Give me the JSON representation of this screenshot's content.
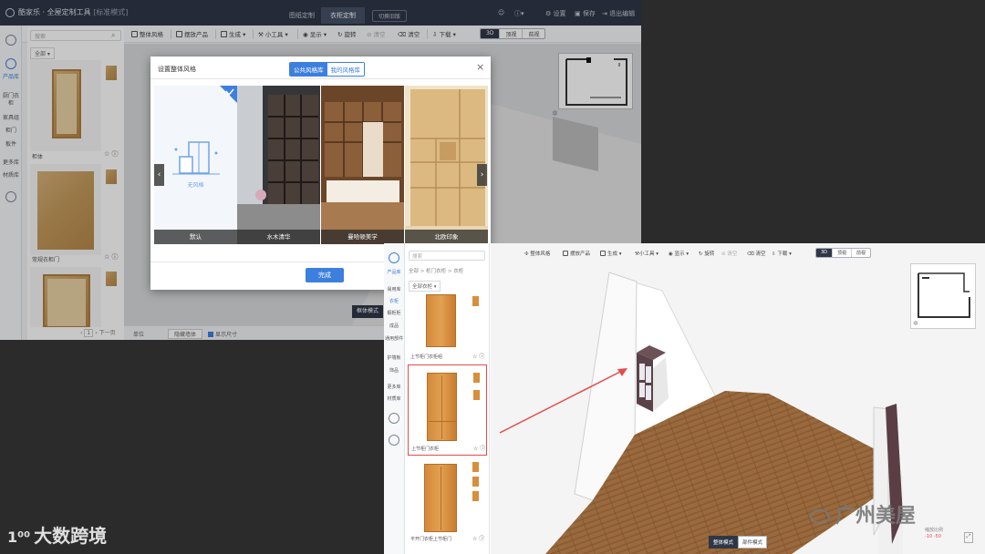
{
  "window1": {
    "app_title": "酷家乐 · 全屋定制工具",
    "mode_badge": "[标准模式]",
    "tabs": [
      "图纸定制",
      "衣柜定制"
    ],
    "switch_label": "切换旧版",
    "top_right": [
      "设置",
      "保存",
      "退出编辑"
    ],
    "toolbar": [
      "整体风格",
      "摆放产品",
      "生成",
      "小工具",
      "显示",
      "旋转",
      "清空",
      "清空",
      "下载"
    ],
    "view_modes": [
      "3D",
      "顶视",
      "前视"
    ],
    "rail": {
      "product_lib": "产品库",
      "cats": [
        "厨门衣柜",
        "家具组",
        "柜门",
        "板件"
      ],
      "more1": "更多库",
      "more2": "材质库"
    },
    "search_placeholder": "搜索",
    "filter_label": "全部",
    "products": [
      {
        "caption": "柜体"
      },
      {
        "caption": "常规衣柜门"
      },
      {
        "caption": ""
      }
    ],
    "pager": {
      "page": "1",
      "next": "下一页"
    },
    "bottom": [
      "单位",
      "隐藏墙体",
      "显示尺寸"
    ],
    "frame_mode_btn": "框体模式"
  },
  "modal": {
    "title": "设置整体风格",
    "tabs": [
      "公共风格库",
      "我的风格库"
    ],
    "close": "×",
    "cards": [
      {
        "label": "默认",
        "placeholder": "无风格"
      },
      {
        "label": "水木清华"
      },
      {
        "label": "曼哈顿美学"
      },
      {
        "label": "北欧印象"
      }
    ],
    "done": "完成"
  },
  "window2": {
    "search_placeholder": "搜索",
    "breadcrumb": "全部 > 柜门衣柜 > 衣柜",
    "filter_label": "全部衣柜",
    "rail": {
      "product_lib": "产品库",
      "cats": [
        "易用库",
        "衣柜",
        "橱柜柜",
        "成品",
        "通用部件",
        "护墙板",
        "饰品"
      ],
      "more1": "更多库",
      "more2": "材质库"
    },
    "products": [
      {
        "caption": "上节柜门衣柜组"
      },
      {
        "caption": "上节柜门衣柜"
      },
      {
        "caption": "平开门衣柜上节柜门"
      }
    ],
    "toolbar": [
      "整体风格",
      "摆放产品",
      "生成",
      "小工具",
      "显示",
      "旋转",
      "清空",
      "清空",
      "下载"
    ],
    "view_modes": [
      "3D",
      "顶视",
      "前视"
    ],
    "mode_buttons": [
      "整体模式",
      "部件模式"
    ],
    "zoom": {
      "label": "缩放比例",
      "value": "-10 -50"
    }
  },
  "watermarks": {
    "bottom_left": "大数跨境",
    "bottom_left_mark": "1⁰⁰",
    "bottom_right": "广州美屋"
  },
  "colors": {
    "topbar": "#2f3747",
    "accent_blue": "#3d7fde",
    "selection_red": "#e34c4c",
    "wood": "#c49a5c",
    "orange_wood": "#d88f3b"
  }
}
